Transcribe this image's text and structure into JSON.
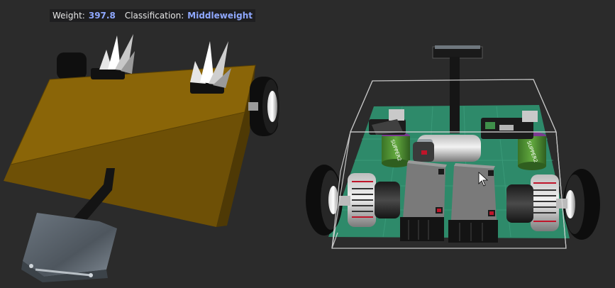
{
  "hud": {
    "weight_label": "Weight:",
    "weight_value": "397.8",
    "classification_label": "Classification:",
    "classification_value": "Middleweight"
  },
  "left_robot": {
    "body_color": "#8a6508",
    "wheel_color": "#111111",
    "hammer_head_color": "#5d6670"
  },
  "right_robot": {
    "base_color": "#2e8a6a",
    "frame_color": "#e8e8e8",
    "battery_top_color": "#7a3b8f",
    "battery_body_color": "#4a8d2f",
    "battery_label": "SUPPER2"
  },
  "colors": {
    "background": "#2b2b2b",
    "hud_value": "#8fa8ff"
  }
}
